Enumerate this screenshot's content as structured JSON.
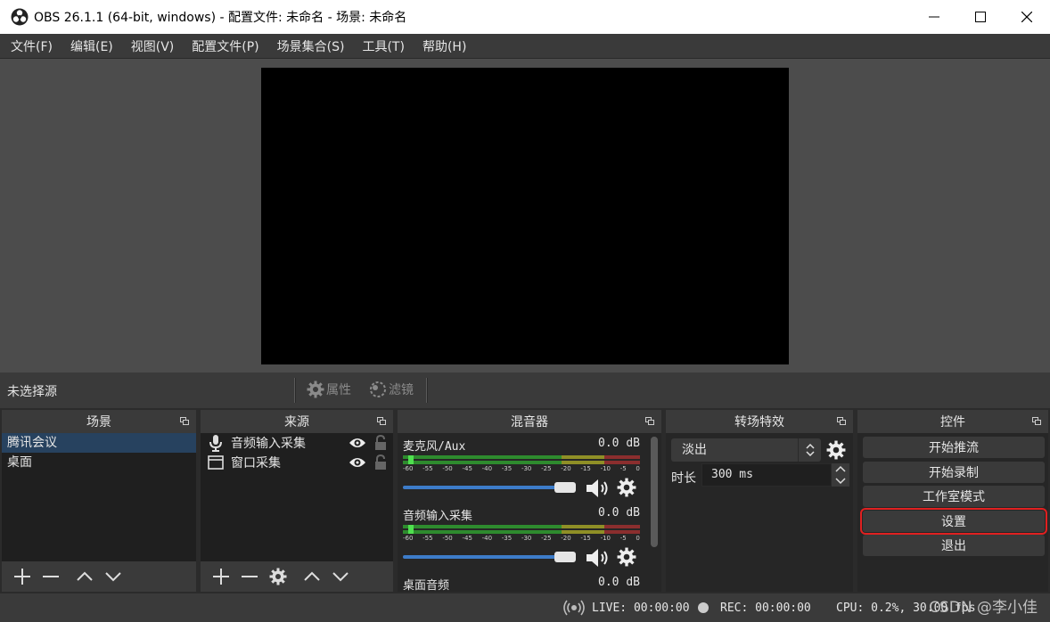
{
  "window": {
    "title": "OBS 26.1.1 (64-bit, windows) - 配置文件: 未命名 - 场景: 未命名"
  },
  "menubar": {
    "items": [
      "文件(F)",
      "编辑(E)",
      "视图(V)",
      "配置文件(P)",
      "场景集合(S)",
      "工具(T)",
      "帮助(H)"
    ]
  },
  "source_toolbar": {
    "no_selection": "未选择源",
    "properties": "属性",
    "filters": "滤镜"
  },
  "scenes": {
    "title": "场景",
    "items": [
      "腾讯会议",
      "桌面"
    ],
    "selected_index": 0
  },
  "sources": {
    "title": "来源",
    "items": [
      {
        "label": "音频输入采集",
        "icon": "microphone-icon"
      },
      {
        "label": "窗口采集",
        "icon": "window-icon"
      }
    ]
  },
  "mixer": {
    "title": "混音器",
    "channels": [
      {
        "name": "麦克风/Aux",
        "db": "0.0 dB",
        "volume": 1.0
      },
      {
        "name": "音频输入采集",
        "db": "0.0 dB",
        "volume": 1.0
      },
      {
        "name": "桌面音频",
        "db": "0.0 dB"
      }
    ],
    "ticks": [
      "-60",
      "-55",
      "-50",
      "-45",
      "-40",
      "-35",
      "-30",
      "-25",
      "-20",
      "-15",
      "-10",
      "-5",
      "0"
    ]
  },
  "transitions": {
    "title": "转场特效",
    "selected": "淡出",
    "duration_label": "时长",
    "duration_value": "300 ms"
  },
  "controls": {
    "title": "控件",
    "buttons": [
      "开始推流",
      "开始录制",
      "工作室模式",
      "设置",
      "退出"
    ],
    "highlighted": "设置"
  },
  "status": {
    "live": "LIVE: 00:00:00",
    "rec": "REC: 00:00:00",
    "cpu": "CPU: 0.2%, 30.00 fps"
  },
  "watermark": "CSDN @李小佳",
  "colors": {
    "selection": "#27425f",
    "meter_green": "#2e8b2e",
    "meter_yellow": "#8f8f26",
    "meter_red": "#8b2e2e",
    "slider_blue": "#3d7cc9",
    "highlight_red": "#e02020"
  }
}
